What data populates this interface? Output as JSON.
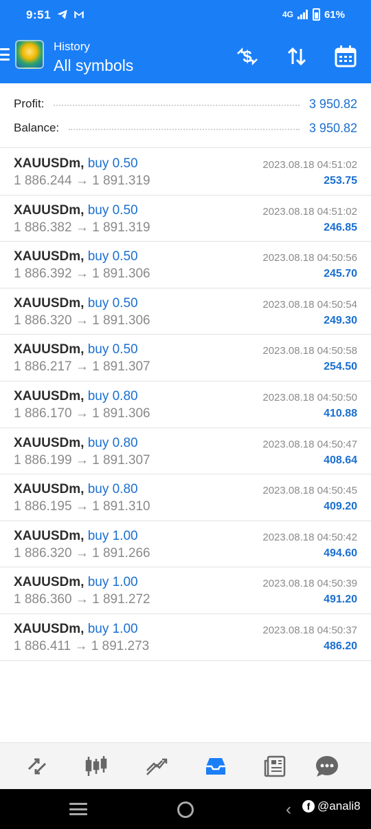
{
  "status_bar": {
    "time": "9:51",
    "network": "4G",
    "battery": "61%"
  },
  "header": {
    "subtitle": "History",
    "title": "All symbols",
    "actions": [
      "dollar-swap-icon",
      "sort-icon",
      "calendar-icon"
    ]
  },
  "summary": {
    "profit_label": "Profit:",
    "profit_value": "3 950.82",
    "balance_label": "Balance:",
    "balance_value": "3 950.82"
  },
  "deals": [
    {
      "symbol": "XAUUSDm,",
      "type": "buy 0.50",
      "open": "1 886.244",
      "arrow": "→",
      "close": "1 891.319",
      "time": "2023.08.18 04:51:02",
      "profit": "253.75"
    },
    {
      "symbol": "XAUUSDm,",
      "type": "buy 0.50",
      "open": "1 886.382",
      "arrow": "→",
      "close": "1 891.319",
      "time": "2023.08.18 04:51:02",
      "profit": "246.85"
    },
    {
      "symbol": "XAUUSDm,",
      "type": "buy 0.50",
      "open": "1 886.392",
      "arrow": "→",
      "close": "1 891.306",
      "time": "2023.08.18 04:50:56",
      "profit": "245.70"
    },
    {
      "symbol": "XAUUSDm,",
      "type": "buy 0.50",
      "open": "1 886.320",
      "arrow": "→",
      "close": "1 891.306",
      "time": "2023.08.18 04:50:54",
      "profit": "249.30"
    },
    {
      "symbol": "XAUUSDm,",
      "type": "buy 0.50",
      "open": "1 886.217",
      "arrow": "→",
      "close": "1 891.307",
      "time": "2023.08.18 04:50:58",
      "profit": "254.50"
    },
    {
      "symbol": "XAUUSDm,",
      "type": "buy 0.80",
      "open": "1 886.170",
      "arrow": "→",
      "close": "1 891.306",
      "time": "2023.08.18 04:50:50",
      "profit": "410.88"
    },
    {
      "symbol": "XAUUSDm,",
      "type": "buy 0.80",
      "open": "1 886.199",
      "arrow": "→",
      "close": "1 891.307",
      "time": "2023.08.18 04:50:47",
      "profit": "408.64"
    },
    {
      "symbol": "XAUUSDm,",
      "type": "buy 0.80",
      "open": "1 886.195",
      "arrow": "→",
      "close": "1 891.310",
      "time": "2023.08.18 04:50:45",
      "profit": "409.20"
    },
    {
      "symbol": "XAUUSDm,",
      "type": "buy 1.00",
      "open": "1 886.320",
      "arrow": "→",
      "close": "1 891.266",
      "time": "2023.08.18 04:50:42",
      "profit": "494.60"
    },
    {
      "symbol": "XAUUSDm,",
      "type": "buy 1.00",
      "open": "1 886.360",
      "arrow": "→",
      "close": "1 891.272",
      "time": "2023.08.18 04:50:39",
      "profit": "491.20"
    },
    {
      "symbol": "XAUUSDm,",
      "type": "buy 1.00",
      "open": "1 886.411",
      "arrow": "→",
      "close": "1 891.273",
      "time": "2023.08.18 04:50:37",
      "profit": "486.20"
    }
  ],
  "bottom_nav": {
    "items": [
      "quotes-icon",
      "chart-icon",
      "trade-icon",
      "history-icon",
      "news-icon",
      "messages-icon"
    ],
    "active": "history-icon"
  },
  "watermark": "@anali8",
  "colors": {
    "primary": "#1a7ef7",
    "value_blue": "#1a6fd0",
    "muted": "#8a8a8a"
  }
}
